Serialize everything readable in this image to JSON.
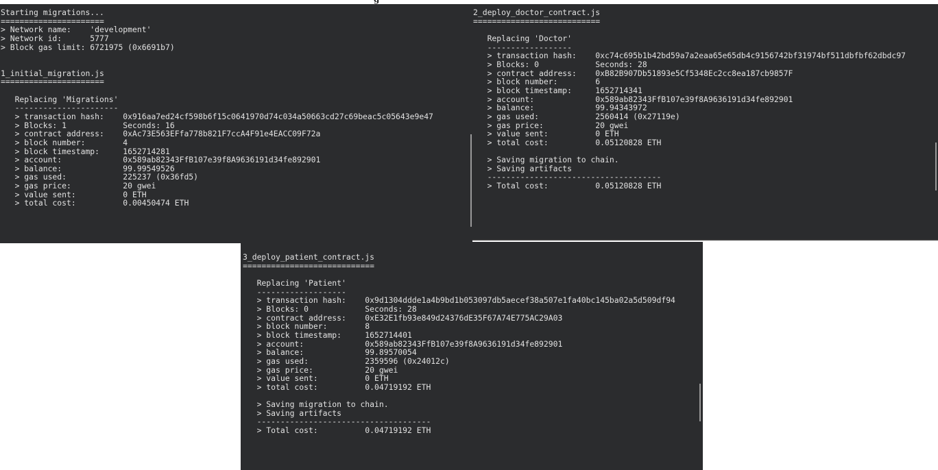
{
  "top_clipped_text": "g",
  "terminals": [
    {
      "lines": [
        "Starting migrations...",
        "======================",
        "> Network name:    'development'",
        "> Network id:      5777",
        "> Block gas limit: 6721975 (0x6691b7)",
        "",
        "",
        "1_initial_migration.js",
        "======================",
        "",
        "   Replacing 'Migrations'",
        "   ----------------------",
        "   > transaction hash:    0x916aa7ed24cf598b6f15c0641970d74c034a50663cd27c69beac5c05643e9e47",
        "   > Blocks: 1            Seconds: 16",
        "   > contract address:    0xAc73E563EFfa778b821F7ccA4F91e4EACC09F72a",
        "   > block number:        4",
        "   > block timestamp:     1652714281",
        "   > account:             0x589ab82343FfB107e39f8A9636191d34fe892901",
        "   > balance:             99.99549526",
        "   > gas used:            225237 (0x36fd5)",
        "   > gas price:           20 gwei",
        "   > value sent:          0 ETH",
        "   > total cost:          0.00450474 ETH"
      ]
    },
    {
      "lines": [
        "2_deploy_doctor_contract.js",
        "===========================",
        "",
        "   Replacing 'Doctor'",
        "   ------------------",
        "   > transaction hash:    0xc74c695b1b42bd59a7a2eaa65e65db4c9156742bf31974bf511dbfbf62dbdc97",
        "   > Blocks: 0            Seconds: 28",
        "   > contract address:    0xB82B907Db51893e5Cf5348Ec2cc8ea187cb9857F",
        "   > block number:        6",
        "   > block timestamp:     1652714341",
        "   > account:             0x589ab82343FfB107e39f8A9636191d34fe892901",
        "   > balance:             99.94343972",
        "   > gas used:            2560414 (0x27119e)",
        "   > gas price:           20 gwei",
        "   > value sent:          0 ETH",
        "   > total cost:          0.05120828 ETH",
        "",
        "   > Saving migration to chain.",
        "   > Saving artifacts",
        "   -------------------------------------",
        "   > Total cost:          0.05120828 ETH"
      ]
    },
    {
      "lines": [
        "3_deploy_patient_contract.js",
        "============================",
        "",
        "   Replacing 'Patient'",
        "   -------------------",
        "   > transaction hash:    0x9d1304ddde1a4b9bd1b053097db5aecef38a507e1fa40bc145ba02a5d509df94",
        "   > Blocks: 0            Seconds: 28",
        "   > contract address:    0xE32E1fb93e849d24376dE35F67A74E775AC29A03",
        "   > block number:        8",
        "   > block timestamp:     1652714401",
        "   > account:             0x589ab82343FfB107e39f8A9636191d34fe892901",
        "   > balance:             99.89570054",
        "   > gas used:            2359596 (0x24012c)",
        "   > gas price:           20 gwei",
        "   > value sent:          0 ETH",
        "   > total cost:          0.04719192 ETH",
        "",
        "   > Saving migration to chain.",
        "   > Saving artifacts",
        "   -------------------------------------",
        "   > Total cost:          0.04719192 ETH"
      ]
    }
  ]
}
